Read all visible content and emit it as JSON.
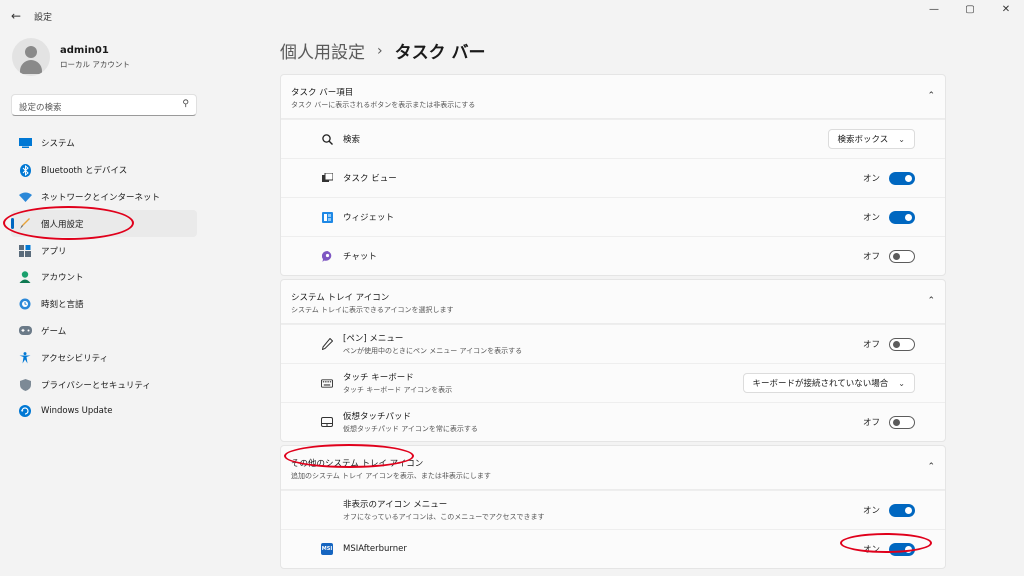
{
  "window": {
    "title": "設定",
    "back_icon": "←",
    "minimize": "—",
    "maximize": "▢",
    "close": "✕"
  },
  "profile": {
    "name": "admin01",
    "account_type": "ローカル アカウント"
  },
  "search": {
    "placeholder": "設定の検索"
  },
  "sidebar": {
    "items": [
      {
        "label": "システム",
        "icon": "system-icon"
      },
      {
        "label": "Bluetooth とデバイス",
        "icon": "bluetooth-icon"
      },
      {
        "label": "ネットワークとインターネット",
        "icon": "network-icon"
      },
      {
        "label": "個人用設定",
        "icon": "personalization-icon",
        "active": true
      },
      {
        "label": "アプリ",
        "icon": "apps-icon"
      },
      {
        "label": "アカウント",
        "icon": "account-icon"
      },
      {
        "label": "時刻と言語",
        "icon": "time-language-icon"
      },
      {
        "label": "ゲーム",
        "icon": "gaming-icon"
      },
      {
        "label": "アクセシビリティ",
        "icon": "accessibility-icon"
      },
      {
        "label": "プライバシーとセキュリティ",
        "icon": "privacy-icon"
      },
      {
        "label": "Windows Update",
        "icon": "windows-update-icon"
      }
    ]
  },
  "breadcrumb": {
    "parent": "個人用設定",
    "separator": "›",
    "current": "タスク バー"
  },
  "sections": {
    "taskbar_items": {
      "title": "タスク バー項目",
      "subtitle": "タスク バーに表示されるボタンを表示または非表示にする",
      "rows": [
        {
          "label": "検索",
          "control": "dropdown",
          "value": "検索ボックス"
        },
        {
          "label": "タスク ビュー",
          "control": "toggle",
          "value": "オン"
        },
        {
          "label": "ウィジェット",
          "control": "toggle",
          "value": "オン"
        },
        {
          "label": "チャット",
          "control": "toggle",
          "value": "オフ"
        }
      ]
    },
    "system_tray": {
      "title": "システム トレイ アイコン",
      "subtitle": "システム トレイに表示できるアイコンを選択します",
      "rows": [
        {
          "label": "[ペン] メニュー",
          "sub": "ペンが使用中のときにペン メニュー アイコンを表示する",
          "control": "toggle",
          "value": "オフ"
        },
        {
          "label": "タッチ キーボード",
          "sub": "タッチ キーボード アイコンを表示",
          "control": "dropdown",
          "value": "キーボードが接続されていない場合"
        },
        {
          "label": "仮想タッチパッド",
          "sub": "仮想タッチパッド アイコンを常に表示する",
          "control": "toggle",
          "value": "オフ"
        }
      ]
    },
    "other_tray": {
      "title": "その他のシステム トレイ アイコン",
      "subtitle": "追加のシステム トレイ アイコンを表示、または非表示にします",
      "rows": [
        {
          "label": "非表示のアイコン メニュー",
          "sub": "オフになっているアイコンは、このメニューでアクセスできます",
          "control": "toggle",
          "value": "オン"
        },
        {
          "label": "MSIAfterburner",
          "control": "toggle",
          "value": "オン",
          "badge": "MSI"
        }
      ]
    }
  },
  "colors": {
    "accent": "#0067c0",
    "annotation": "#e0001b"
  }
}
